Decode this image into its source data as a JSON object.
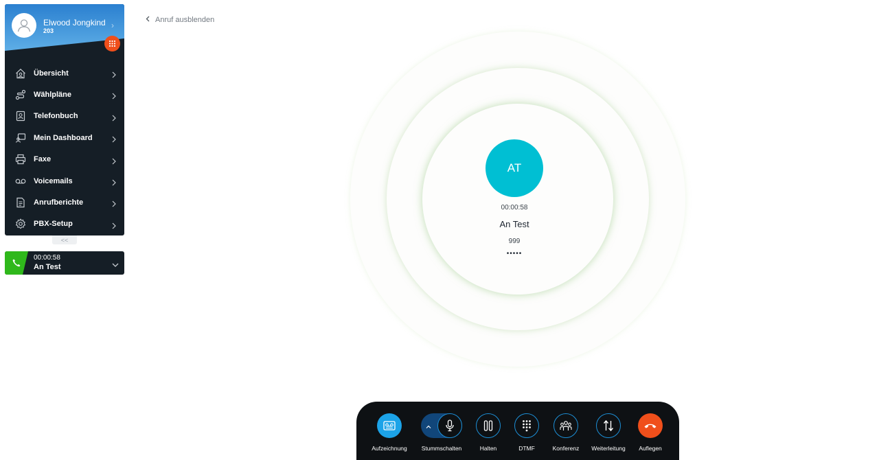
{
  "user": {
    "name": "Elwood Jongkind",
    "extension": "203"
  },
  "nav": {
    "items": [
      {
        "label": "Übersicht",
        "icon": "home-icon"
      },
      {
        "label": "Wählpläne",
        "icon": "route-icon"
      },
      {
        "label": "Telefonbuch",
        "icon": "contacts-icon"
      },
      {
        "label": "Mein Dashboard",
        "icon": "dashboard-icon"
      },
      {
        "label": "Faxe",
        "icon": "printer-icon"
      },
      {
        "label": "Voicemails",
        "icon": "voicemail-icon"
      },
      {
        "label": "Anrufberichte",
        "icon": "report-icon"
      },
      {
        "label": "PBX-Setup",
        "icon": "gear-icon"
      }
    ]
  },
  "collapse_label": "<<",
  "active_call": {
    "time": "00:00:58",
    "name": "An Test"
  },
  "hide_call_label": "Anruf ausblenden",
  "caller": {
    "initials": "AT",
    "time": "00:00:58",
    "name": "An Test",
    "number": "999",
    "dots": "•••••"
  },
  "controls": {
    "record": "Aufzeichnung",
    "mute": "Stummschalten",
    "hold": "Halten",
    "dtmf": "DTMF",
    "conference": "Konferenz",
    "transfer": "Weiterleitung",
    "hangup": "Auflegen"
  },
  "colors": {
    "sidebar_bg": "#151e26",
    "header_blue": "#2f86d3",
    "accent_orange": "#f04f1b",
    "call_green": "#2fb81b",
    "avatar_cyan": "#00bfd3",
    "control_border": "#1d8fd6",
    "hangup_red": "#f04f1b"
  }
}
